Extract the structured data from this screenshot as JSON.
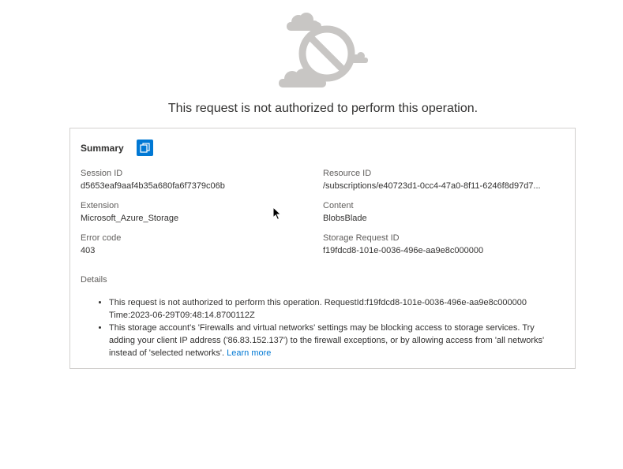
{
  "message": "This request is not authorized to perform this operation.",
  "summary": {
    "title": "Summary",
    "copy_icon": "copy-icon",
    "fields": {
      "session_id": {
        "label": "Session ID",
        "value": "d5653eaf9aaf4b35a680fa6f7379c06b"
      },
      "resource_id": {
        "label": "Resource ID",
        "value": "/subscriptions/e40723d1-0cc4-47a0-8f11-6246f8d97d7..."
      },
      "extension": {
        "label": "Extension",
        "value": "Microsoft_Azure_Storage"
      },
      "content": {
        "label": "Content",
        "value": "BlobsBlade"
      },
      "error_code": {
        "label": "Error code",
        "value": "403"
      },
      "storage_request_id": {
        "label": "Storage Request ID",
        "value": "f19fdcd8-101e-0036-496e-aa9e8c000000"
      }
    }
  },
  "details": {
    "title": "Details",
    "items": [
      {
        "text": "This request is not authorized to perform this operation. RequestId:f19fdcd8-101e-0036-496e-aa9e8c000000 Time:2023-06-29T09:48:14.8700112Z"
      },
      {
        "text": "This storage account's 'Firewalls and virtual networks' settings may be blocking access to storage services. Try adding your client IP address ('86.83.152.137') to the firewall exceptions, or by allowing access from 'all networks' instead of 'selected networks'.",
        "link": "Learn more"
      }
    ]
  },
  "colors": {
    "accent": "#0078d4",
    "border": "#d2d0ce",
    "illustration": "#c8c6c4"
  }
}
